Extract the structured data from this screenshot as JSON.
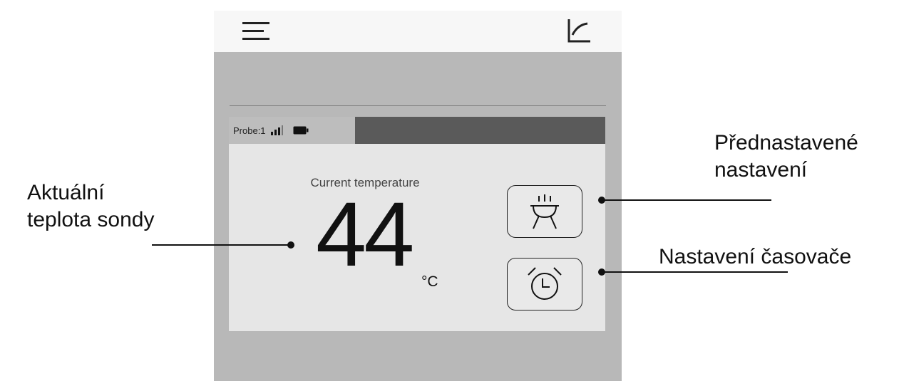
{
  "app": {
    "probe_label": "Probe:1",
    "caption": "Current temperature",
    "temperature": "44",
    "unit": "°C"
  },
  "icons": {
    "menu": "hamburger-menu-icon",
    "chart": "line-chart-icon",
    "signal": "signal-strength-icon",
    "battery": "battery-icon",
    "preset": "grill-icon",
    "timer": "alarm-clock-icon"
  },
  "annotations": {
    "current_temp_line1": "Aktuální",
    "current_temp_line2": "teplota sondy",
    "preset_line1": "Přednastavené",
    "preset_line2": "nastavení",
    "timer": "Nastavení časovače"
  },
  "colors": {
    "topbar": "#f7f7f7",
    "background": "#b8b8b8",
    "card": "#e6e6e6",
    "probe_tab": "#bdbdbd",
    "probe_bar": "#5a5a5a"
  }
}
